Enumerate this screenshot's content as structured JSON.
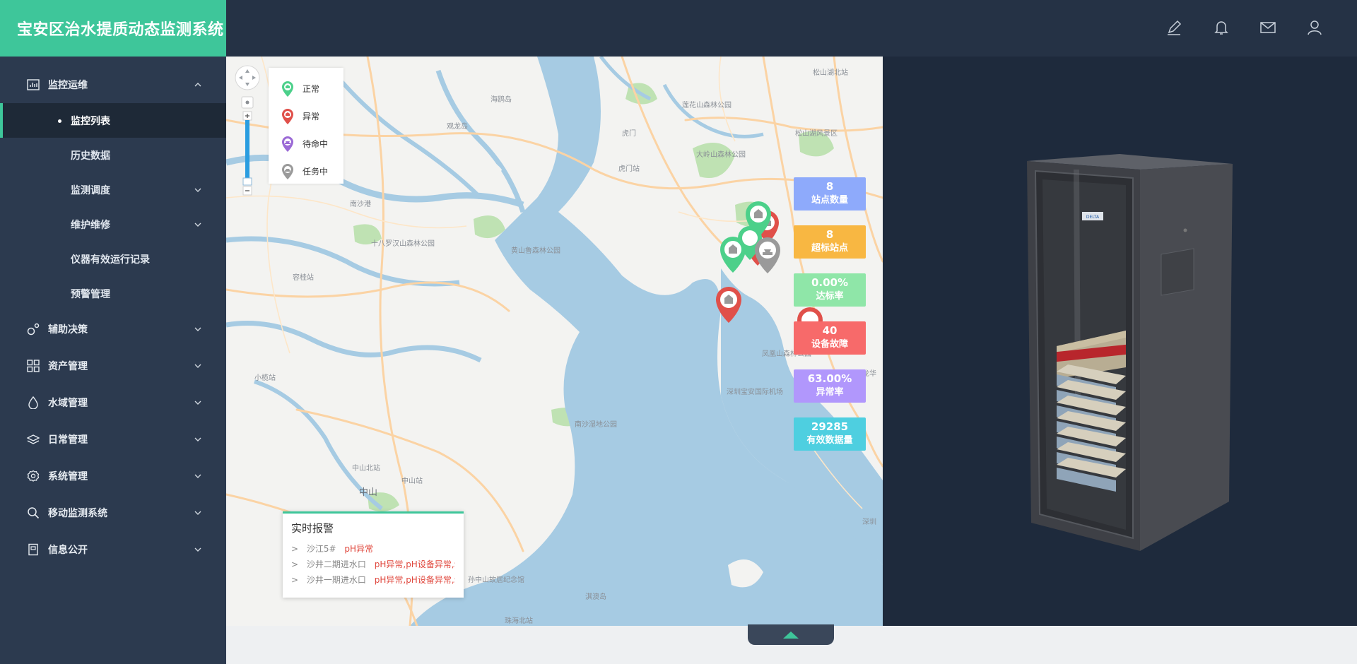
{
  "app": {
    "title": "宝安区治水提质动态监测系统"
  },
  "sidebar": {
    "groups": [
      {
        "label": "监控运维",
        "icon": "chart-icon",
        "expanded": true,
        "children": [
          {
            "label": "监控列表",
            "active": true
          },
          {
            "label": "历史数据"
          },
          {
            "label": "监测调度",
            "has_children": true
          },
          {
            "label": "维护维修",
            "has_children": true
          },
          {
            "label": "仪器有效运行记录"
          },
          {
            "label": "预警管理"
          }
        ]
      },
      {
        "label": "辅助决策",
        "icon": "decision-icon"
      },
      {
        "label": "资产管理",
        "icon": "grid-icon"
      },
      {
        "label": "水域管理",
        "icon": "water-drop-icon"
      },
      {
        "label": "日常管理",
        "icon": "layers-icon"
      },
      {
        "label": "系统管理",
        "icon": "gear-icon"
      },
      {
        "label": "移动监测系统",
        "icon": "search-icon"
      },
      {
        "label": "信息公开",
        "icon": "book-icon"
      }
    ]
  },
  "header": {
    "icons": [
      "edit-icon",
      "bell-icon",
      "mail-icon",
      "user-icon"
    ]
  },
  "map": {
    "legend": [
      {
        "label": "正常",
        "color": "#4cd08a"
      },
      {
        "label": "异常",
        "color": "#e0504a"
      },
      {
        "label": "待命中",
        "color": "#9b6ad6"
      },
      {
        "label": "任务中",
        "color": "#9a9a9a"
      }
    ],
    "labels": {
      "l1": "海鸥岛",
      "l2": "观龙岛",
      "l3": "莲花山森林公园",
      "l4": "松山湖北站",
      "l5": "松山湖风景区",
      "l6": "大岭山森林公园",
      "l7": "虎门站",
      "l8": "十八罗汉山森林公园",
      "l9": "黄山鲁森林公园",
      "l10": "容桂站",
      "l11": "小榄站",
      "l12": "凤凰山森林公园",
      "l13": "深圳宝安国际机场",
      "l14": "南沙湿地公园",
      "l15": "中山北站",
      "l16": "中山站",
      "l17": "中山",
      "l18": "孙中山故居纪念馆",
      "l19": "淇澳岛",
      "l20": "珠海北站",
      "l21": "深圳",
      "l22": "南沙港",
      "l23": "龙华",
      "l24": "虎门"
    },
    "stats": [
      {
        "value": "8",
        "label": "站点数量",
        "color": "#8eaafb"
      },
      {
        "value": "8",
        "label": "超标站点",
        "color": "#f8b742"
      },
      {
        "value": "0.00%",
        "label": "达标率",
        "color": "#8fe6a8"
      },
      {
        "value": "40",
        "label": "设备故障",
        "color": "#f76a6a"
      },
      {
        "value": "63.00%",
        "label": "异常率",
        "color": "#b197fc"
      },
      {
        "value": "29285",
        "label": "有效数据量",
        "color": "#4ecfe0"
      }
    ],
    "alarm": {
      "title": "实时报警",
      "rows": [
        {
          "arrow": ">",
          "site": "沙江5#",
          "msg": "pH异常"
        },
        {
          "arrow": ">",
          "site": "沙井二期进水口",
          "msg": "pH异常,pH设备异常,$"
        },
        {
          "arrow": ">",
          "site": "沙井一期进水口",
          "msg": "pH异常,pH设备异常,$"
        }
      ]
    }
  },
  "cabinet": {
    "brand": "DELTA"
  },
  "colors": {
    "accent": "#3ec69a",
    "sidebar": "#2c3a4f",
    "header": "#253245",
    "panel": "#1e2a3c",
    "water": "#a6cbe3",
    "road": "#fbd3a4"
  }
}
